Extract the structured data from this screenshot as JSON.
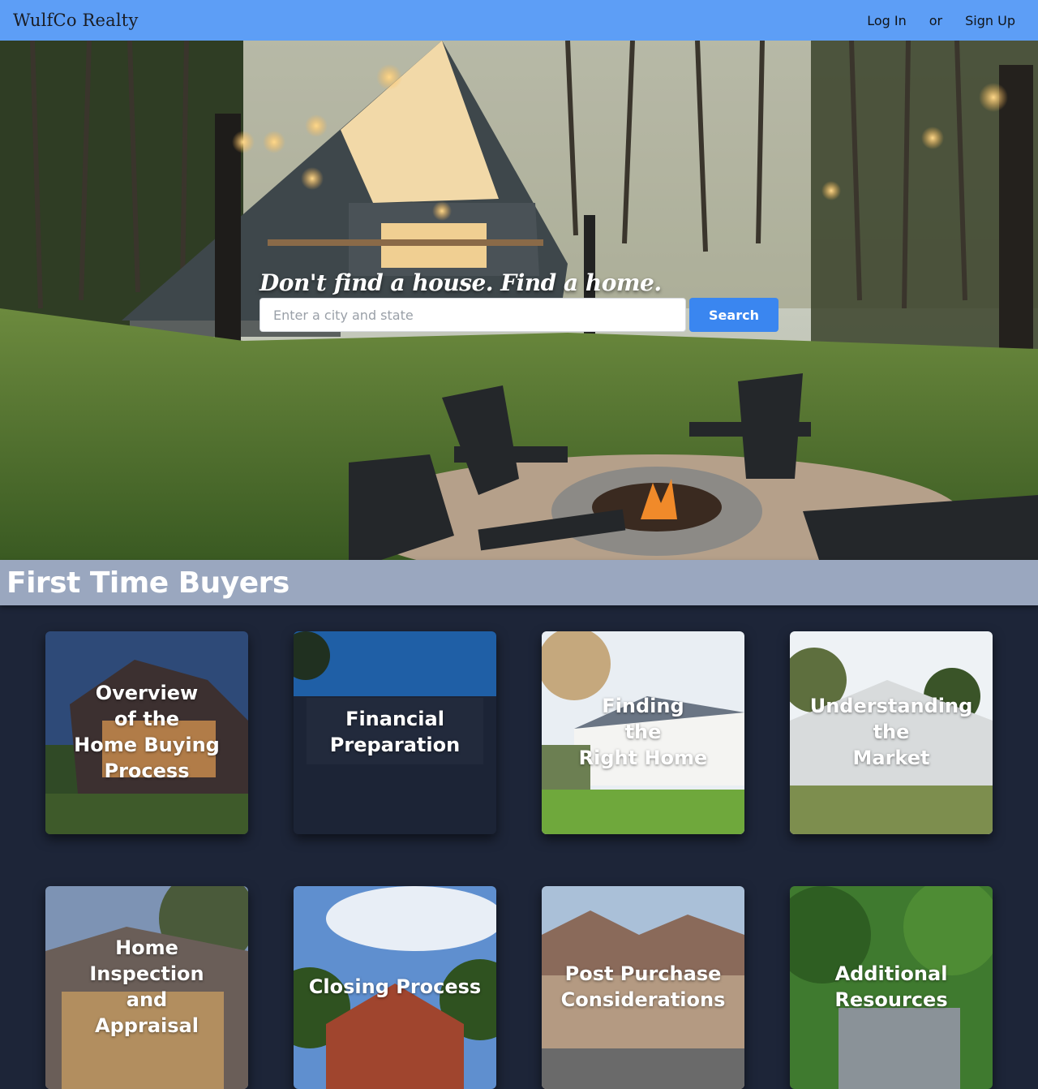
{
  "header": {
    "brand": "WulfCo Realty",
    "login": "Log In",
    "or": "or",
    "signup": "Sign Up"
  },
  "hero": {
    "tagline": "Don't find a house. Find a home.",
    "search_placeholder": "Enter a city and state",
    "search_button": "Search"
  },
  "section": {
    "title": "First Time Buyers"
  },
  "cards": [
    {
      "label": "Overview of the Home Buying Process",
      "lines": [
        "Overview",
        "of the",
        "Home Buying",
        "Process"
      ]
    },
    {
      "label": "Financial Preparation",
      "lines": [
        "Financial",
        "Preparation"
      ]
    },
    {
      "label": "Finding the Right Home",
      "lines": [
        "Finding",
        "the",
        "Right Home"
      ]
    },
    {
      "label": "Understanding the Market",
      "lines": [
        "Understanding",
        "the",
        "Market"
      ]
    },
    {
      "label": "Home Inspection and Appraisal",
      "lines": [
        "Home",
        "Inspection",
        "and",
        "Appraisal"
      ]
    },
    {
      "label": "Closing Process",
      "lines": [
        "Closing Process"
      ]
    },
    {
      "label": "Post Purchase Considerations",
      "lines": [
        "Post Purchase",
        "Considerations"
      ]
    },
    {
      "label": "Additional Resources",
      "lines": [
        "Additional",
        "Resources"
      ]
    }
  ],
  "colors": {
    "header_bg": "#5d9ef6",
    "page_bg": "#1d2538",
    "section_bar": "#9aa7bf",
    "search_button": "#3a86f0"
  }
}
